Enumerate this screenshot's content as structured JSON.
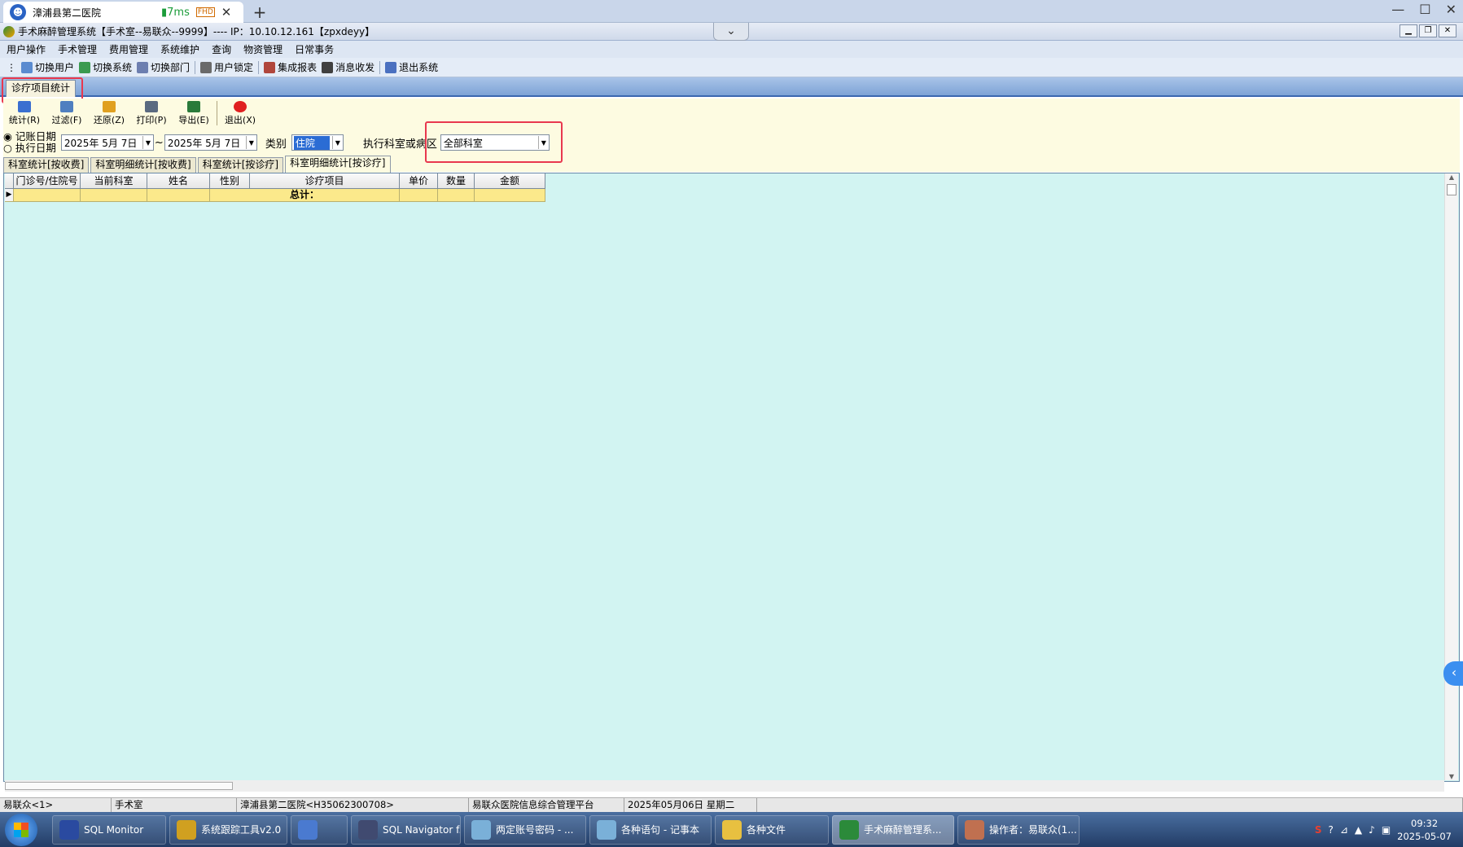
{
  "browser": {
    "tab_title": "漳浦县第二医院",
    "latency": "7ms",
    "quality_badge": "FHD",
    "new_tab": "+"
  },
  "window_controls": {
    "minimize": "—",
    "maximize": "☐",
    "close": "✕"
  },
  "app": {
    "title": "手术麻醉管理系统【手术室--易联众--9999】---- IP：10.10.12.161【zpxdeyy】",
    "collapse_glyph": "⌄"
  },
  "menu": [
    "用户操作",
    "手术管理",
    "费用管理",
    "系统维护",
    "查询",
    "物资管理",
    "日常事务"
  ],
  "toolbar": {
    "items": [
      {
        "label": "切换用户",
        "icon": "switch-user-icon",
        "color": "#5a8bd0"
      },
      {
        "label": "切换系统",
        "icon": "switch-system-icon",
        "color": "#3a9a50"
      },
      {
        "label": "切换部门",
        "icon": "switch-dept-icon",
        "color": "#6d7fb0"
      },
      {
        "label": "用户锁定",
        "icon": "lock-icon",
        "color": "#6a6a6a"
      },
      {
        "label": "集成报表",
        "icon": "report-icon",
        "color": "#b0463c"
      },
      {
        "label": "消息收发",
        "icon": "message-icon",
        "color": "#404040"
      },
      {
        "label": "退出系统",
        "icon": "exit-icon",
        "color": "#4a70c0"
      }
    ]
  },
  "form_tab": "诊疗项目统计",
  "form": {
    "buttons": [
      {
        "label": "统计(R)",
        "icon": "refresh-icon",
        "color": "#3a6fd0"
      },
      {
        "label": "过滤(F)",
        "icon": "filter-icon",
        "color": "#4f7fc0"
      },
      {
        "label": "还原(Z)",
        "icon": "undo-icon",
        "color": "#e0a020"
      },
      {
        "label": "打印(P)",
        "icon": "print-icon",
        "color": "#5a6a80"
      },
      {
        "label": "导出(E)",
        "icon": "export-icon",
        "color": "#2a7a3a"
      },
      {
        "label": "退出(X)",
        "icon": "power-icon",
        "color": "#e02020"
      }
    ],
    "radio_billing_date": "记账日期",
    "radio_exec_date": "执行日期",
    "date_from": "2025年 5月 7日",
    "tilde": "~",
    "date_to": "2025年 5月 7日",
    "category_label": "类别",
    "category_value": "住院",
    "dept_label": "执行科室或病区",
    "dept_value": "全部科室"
  },
  "subtabs": [
    "科室统计[按收费]",
    "科室明细统计[按收费]",
    "科室统计[按诊疗]",
    "科室明细统计[按诊疗]"
  ],
  "grid": {
    "columns": [
      "门诊号/住院号",
      "当前科室",
      "姓名",
      "性别",
      "诊疗项目",
      "单价",
      "数量",
      "金额"
    ],
    "total_label": "总计："
  },
  "status": [
    "易联众<1>",
    "手术室",
    "漳浦县第二医院<H35062300708>",
    "易联众医院信息综合管理平台",
    "2025年05月06日 星期二"
  ],
  "taskbar": {
    "items": [
      {
        "label": "SQL Monitor",
        "color": "#2a4aa0"
      },
      {
        "label": "系统跟踪工具v2.0",
        "color": "#d0a020"
      },
      {
        "label": "",
        "color": "#4a7ad0"
      },
      {
        "label": "SQL Navigator f...",
        "color": "#404a70"
      },
      {
        "label": "两定账号密码 - ...",
        "color": "#7ab0d8"
      },
      {
        "label": "各种语句 - 记事本",
        "color": "#7ab0d8"
      },
      {
        "label": "各种文件",
        "color": "#e8c040"
      },
      {
        "label": "手术麻醉管理系...",
        "color": "#2b8a3a"
      },
      {
        "label": "操作者：易联众(1...",
        "color": "#c07050"
      }
    ],
    "time": "09:32",
    "date": "2025-05-07"
  }
}
